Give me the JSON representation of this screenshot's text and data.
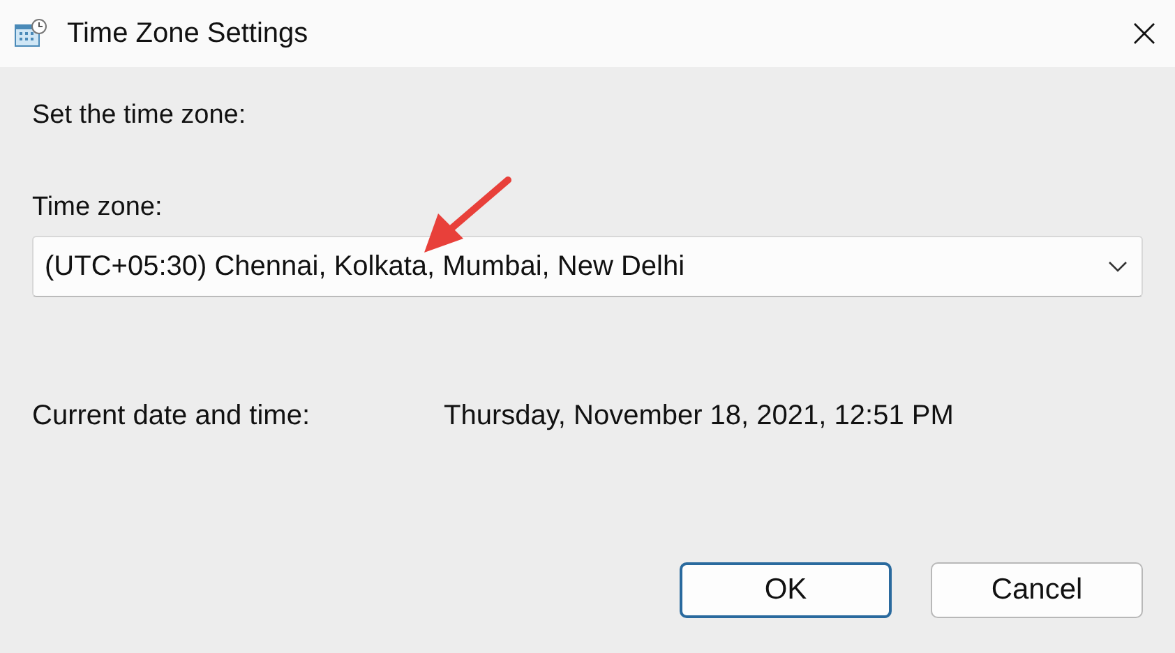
{
  "window": {
    "title": "Time Zone Settings"
  },
  "heading": "Set the time zone:",
  "time_zone": {
    "label": "Time zone:",
    "value": "(UTC+05:30) Chennai, Kolkata, Mumbai, New Delhi"
  },
  "current": {
    "label": "Current date and time:",
    "value": "Thursday, November 18, 2021, 12:51 PM"
  },
  "buttons": [
    {
      "label": "OK",
      "default": true
    },
    {
      "label": "Cancel",
      "default": false
    }
  ]
}
